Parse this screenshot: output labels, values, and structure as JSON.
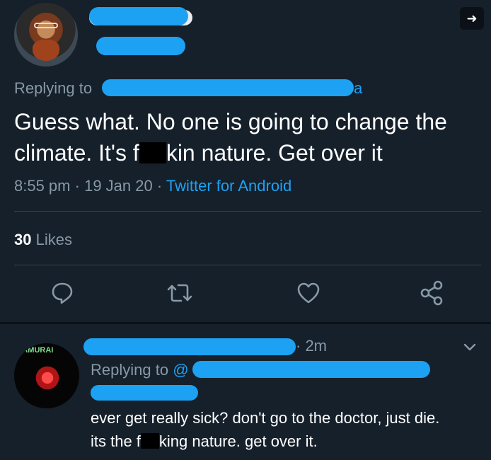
{
  "tweet": {
    "replying_prefix": "Replying to",
    "replying_tail": "a",
    "text_part1": "Guess what. No one is going to change the climate. It's f",
    "text_part2": "kin nature. Get over it",
    "time": "8:55 pm",
    "dot": "·",
    "date": "19 Jan 20",
    "source": "Twitter for Android",
    "likes_count": "30",
    "likes_label": "Likes",
    "share_arrow": "➜"
  },
  "reply": {
    "avatar_brand": "SAMURAI",
    "time": "· 2m",
    "replying_prefix": "Replying to",
    "at_symbol": "@",
    "line1": "ever get really sick? don't go to the doctor, just die.",
    "line2_part1": "its the f",
    "line2_part2": "king nature. get over it."
  },
  "icons": {
    "reply": "reply-icon",
    "retweet": "retweet-icon",
    "like": "heart-icon",
    "share": "share-icon",
    "more": "chevron-down-icon"
  },
  "colors": {
    "background": "#15202b",
    "accent": "#1da1f2",
    "muted": "#8899a6",
    "divider": "#38444d"
  }
}
